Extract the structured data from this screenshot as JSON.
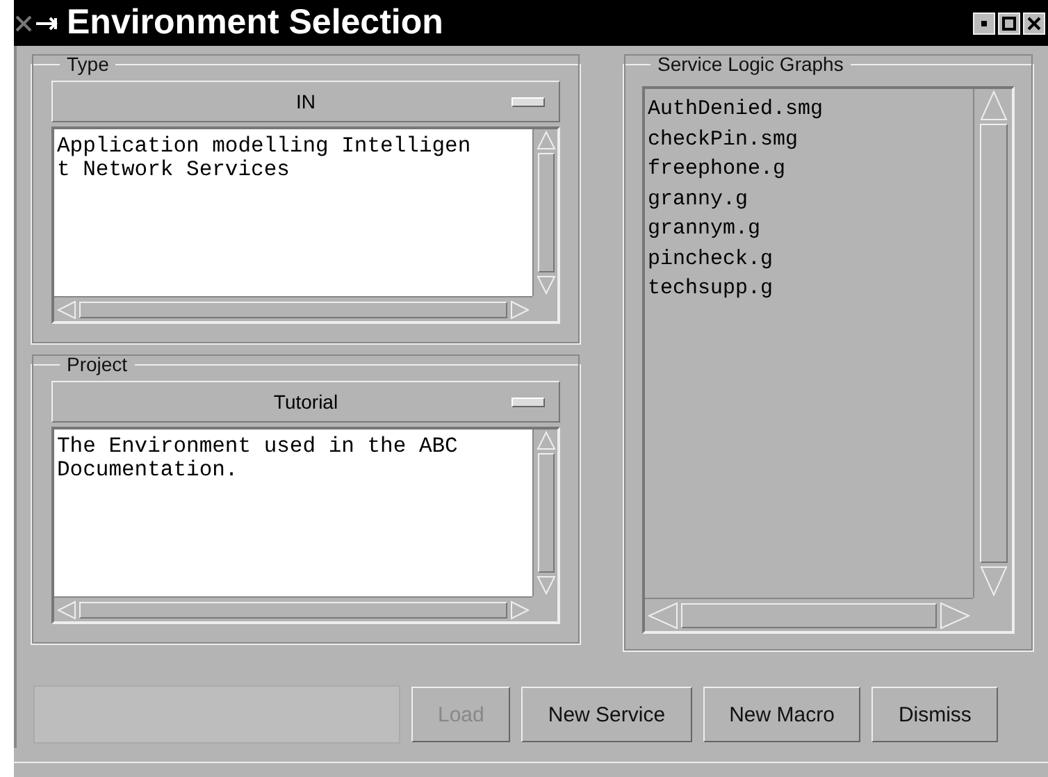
{
  "window": {
    "title": "Environment Selection"
  },
  "type": {
    "label": "Type",
    "option": "IN",
    "description_lines": [
      "Application modelling Intelligen",
      "t Network Services"
    ]
  },
  "project": {
    "label": "Project",
    "option": "Tutorial",
    "description_lines": [
      "The Environment used in the ABC",
      "Documentation."
    ]
  },
  "graphs": {
    "label": "Service Logic Graphs",
    "items": [
      "AuthDenied.smg",
      "checkPin.smg",
      "freephone.g",
      "granny.g",
      "grannym.g",
      "pincheck.g",
      "techsupp.g"
    ]
  },
  "buttons": [
    {
      "label": "Load",
      "disabled": true
    },
    {
      "label": "New Service",
      "disabled": false
    },
    {
      "label": "New Macro",
      "disabled": false
    },
    {
      "label": "Dismiss",
      "disabled": false
    }
  ]
}
